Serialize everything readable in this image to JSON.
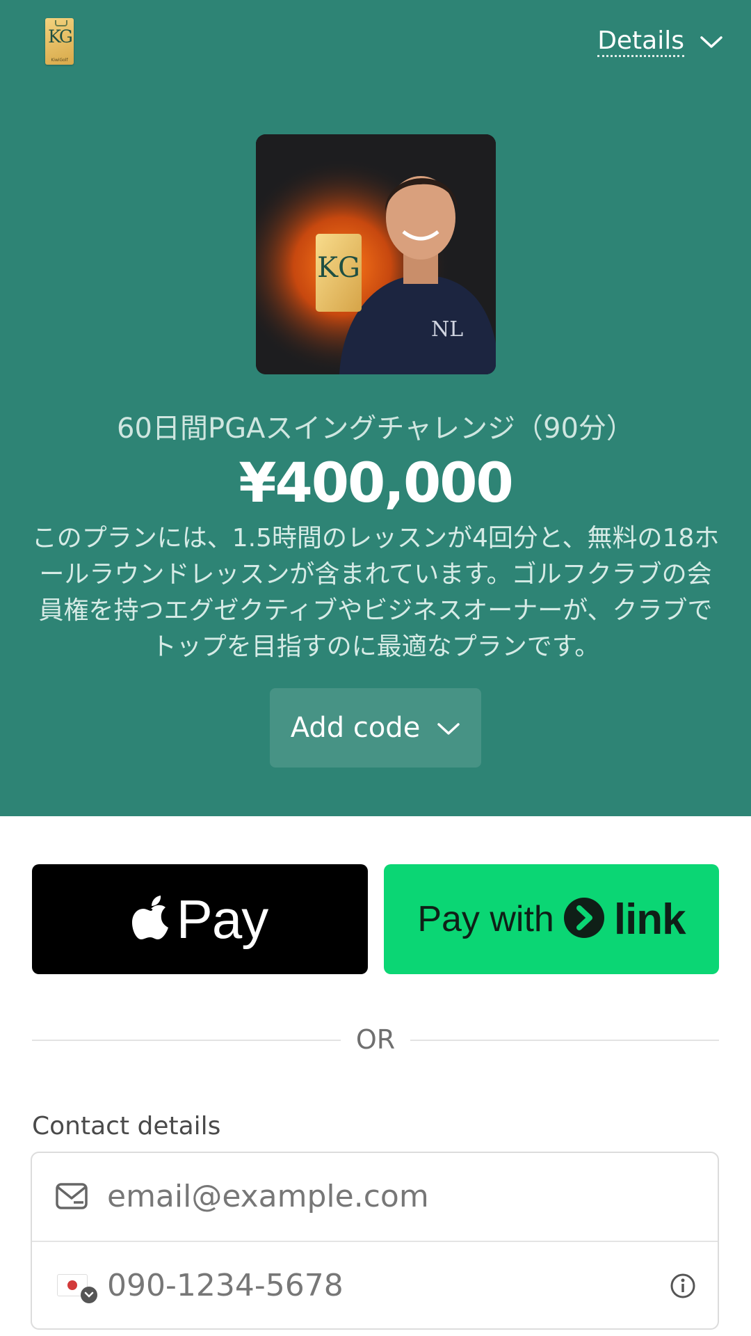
{
  "header": {
    "logo_text": "KG",
    "logo_subtext": "KiwiGolf",
    "details_label": "Details"
  },
  "product": {
    "title": "60日間PGAスイングチャレンジ（90分）",
    "price": "¥400,000",
    "description": "このプランには、1.5時間のレッスンが4回分と、無料の18ホールラウンドレッスンが含まれています。ゴルフクラブの会員権を持つエグゼクティブやビジネスオーナーが、クラブでトップを目指すのに最適なプランです。",
    "image_logo_text": "KG",
    "image_shirt_text": "NL"
  },
  "promo": {
    "add_code_label": "Add code"
  },
  "payment": {
    "apple_pay_label": "Pay",
    "link_pay_prefix": "Pay with",
    "link_pay_brand": "link",
    "divider_label": "OR"
  },
  "contact": {
    "label": "Contact details",
    "email_placeholder": "email@example.com",
    "phone_placeholder": "090-1234-5678"
  },
  "colors": {
    "hero_bg": "#2e8475",
    "link_green": "#0bd674",
    "apple_black": "#000000"
  }
}
